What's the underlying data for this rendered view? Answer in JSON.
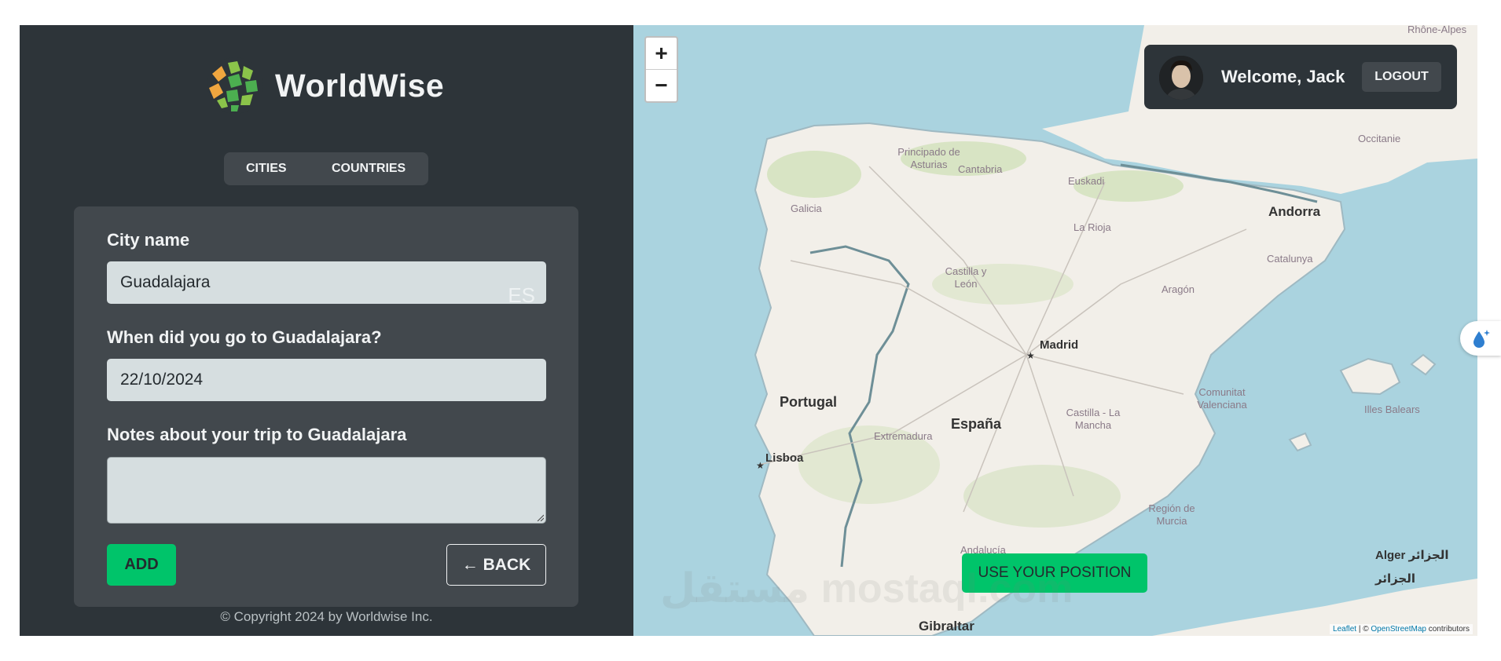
{
  "app": {
    "logo_text": "WorldWise",
    "tabs": [
      {
        "label": "CITIES"
      },
      {
        "label": "COUNTRIES"
      }
    ],
    "footer": "© Copyright 2024 by Worldwise Inc."
  },
  "form": {
    "city_label": "City name",
    "city_value": "Guadalajara",
    "flag_text": "ES",
    "date_label": "When did you go to Guadalajara?",
    "date_value": "22/10/2024",
    "notes_label": "Notes about your trip to Guadalajara",
    "notes_value": "",
    "add_label": "ADD",
    "back_label": "← BACK"
  },
  "map": {
    "zoom_in": "+",
    "zoom_out": "−",
    "user": {
      "welcome": "Welcome, Jack",
      "logout_label": "LOGOUT"
    },
    "use_position_label": "USE YOUR POSITION",
    "labels": {
      "rhone": "Rhône-Alpes",
      "asturias": "Principado de Asturias",
      "cantabria": "Cantabria",
      "euskadi": "Euskadi",
      "occitanie": "Occitanie",
      "galicia": "Galicia",
      "andorra": "Andorra",
      "rioja": "La Rioja",
      "castilla_leon": "Castilla y León",
      "aragon": "Aragón",
      "catalunya": "Catalunya",
      "madrid": "Madrid",
      "portugal": "Portugal",
      "espana": "España",
      "extremadura": "Extremadura",
      "castilla_mancha": "Castilla - La Mancha",
      "valenciana": "Comunitat Valenciana",
      "baleares": "Illes Balears",
      "lisboa": "Lisboa",
      "murcia": "Región de Murcia",
      "andalucia": "Andalucía",
      "gibraltar": "Gibraltar",
      "alger": "Alger الجزائر",
      "alger2": "الجزائر"
    },
    "attribution": {
      "leaflet": "Leaflet",
      "sep": " | © ",
      "osm": "OpenStreetMap",
      "suffix": " contributors"
    }
  },
  "watermark": "مستقل mostaql.com",
  "colors": {
    "sidebar": "#2d3439",
    "panel": "#42484d",
    "accent": "#00c46a",
    "sea": "#aad3df",
    "land": "#f2efe9"
  }
}
